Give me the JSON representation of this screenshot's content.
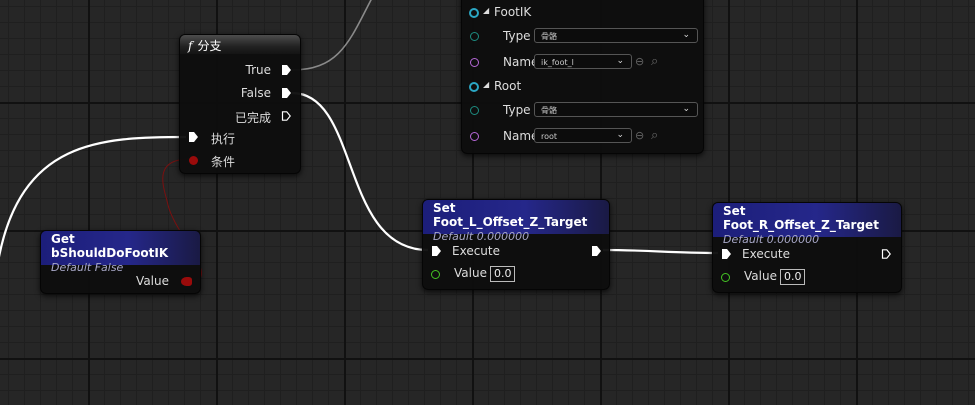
{
  "branch_node": {
    "title_icon": "f",
    "title": "分支",
    "outputs": [
      "True",
      "False",
      "已完成"
    ],
    "inputs": [
      "执行",
      "条件"
    ]
  },
  "getter_node": {
    "title": "Get bShouldDoFootIK",
    "subtitle": "Default False",
    "output_label": "Value"
  },
  "set_left_node": {
    "title": "Set Foot_L_Offset_Z_Target",
    "subtitle": "Default 0.000000",
    "exec_label": "Execute",
    "value_label": "Value",
    "value": "0.0"
  },
  "set_right_node": {
    "title": "Set Foot_R_Offset_Z_Target",
    "subtitle": "Default 0.000000",
    "exec_label": "Execute",
    "value_label": "Value",
    "value": "0.0"
  },
  "bone_node": {
    "groups": [
      {
        "name": "FootIK",
        "type_label": "Type",
        "type_value": "骨骼",
        "name_label": "Name",
        "name_value": "ik_foot_l"
      },
      {
        "name": "Root",
        "type_label": "Type",
        "type_value": "骨骼",
        "name_label": "Name",
        "name_value": "root"
      }
    ],
    "dropdown_glyph": "⌄",
    "use_icon": "⊖",
    "search_icon": "⌕"
  },
  "colors": {
    "exec_pin": "#ffffff",
    "bool_pin": "#9a0b0b",
    "float_pin": "#44c324",
    "struct_pin": "#2ba7c4",
    "name_pin": "#b567d6",
    "teal_pin": "#1d8c80"
  }
}
